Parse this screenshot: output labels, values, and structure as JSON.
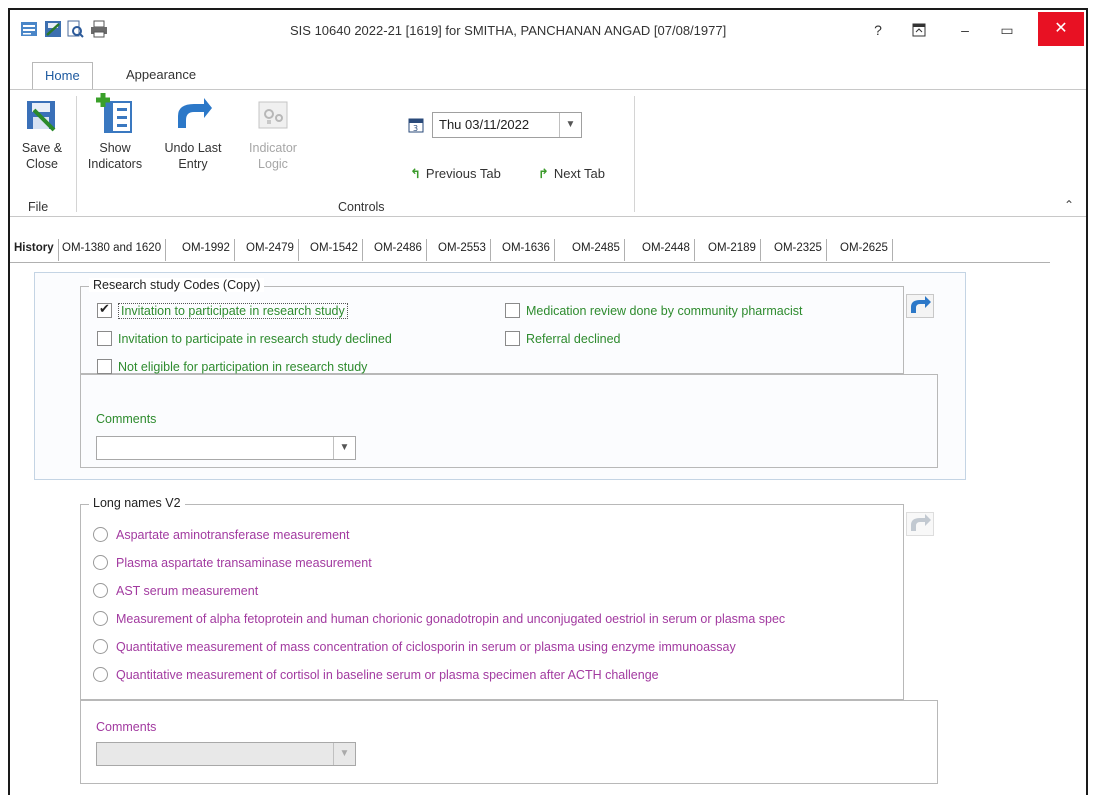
{
  "window": {
    "title": "SIS 10640 2022-21 [1619] for SMITHA, PANCHANAN ANGAD [07/08/1977]",
    "help": "?",
    "minimize": "–",
    "maximize": "▭",
    "close": "✕"
  },
  "ribbon_tabs": [
    "Home",
    "Appearance"
  ],
  "ribbon": {
    "save_close": "Save & Close",
    "show_indicators": "Show Indicators",
    "undo_last_entry": "Undo Last Entry",
    "indicator_logic": "Indicator Logic",
    "date": "Thu 03/11/2022",
    "previous_tab": "Previous Tab",
    "next_tab": "Next Tab",
    "group_file": "File",
    "group_controls": "Controls"
  },
  "tabs": [
    "History",
    "OM-1380 and 1620",
    "OM-1992",
    "OM-2479",
    "OM-1542",
    "OM-2486",
    "OM-2553",
    "OM-1636",
    "OM-2485",
    "OM-2448",
    "OM-2189",
    "OM-2325",
    "OM-2625"
  ],
  "research": {
    "legend": "Research study Codes (Copy)",
    "items": [
      {
        "label": "Invitation to participate in research study",
        "checked": true
      },
      {
        "label": "Invitation to participate in research study declined",
        "checked": false
      },
      {
        "label": "Not eligible for participation in research study",
        "checked": false
      },
      {
        "label": "Medication review done by community pharmacist",
        "checked": false
      },
      {
        "label": "Referral declined",
        "checked": false
      }
    ],
    "comments_label": "Comments",
    "comments_value": ""
  },
  "longnames": {
    "legend": "Long names V2",
    "items": [
      "Aspartate aminotransferase measurement",
      "Plasma aspartate transaminase measurement",
      "AST serum measurement",
      "Measurement of alpha fetoprotein and human chorionic gonadotropin and unconjugated oestriol in serum or plasma spec",
      "Quantitative measurement of mass concentration of ciclosporin in serum or plasma using enzyme immunoassay",
      "Quantitative measurement of cortisol in baseline serum or plasma specimen after ACTH challenge"
    ],
    "comments_label": "Comments",
    "comments_value": ""
  }
}
